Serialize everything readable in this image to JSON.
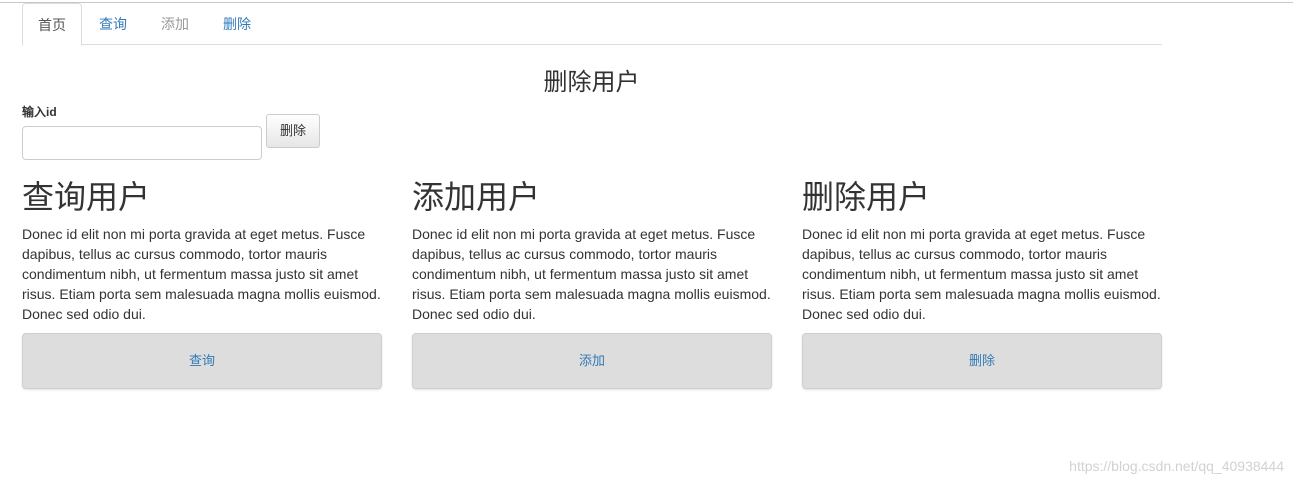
{
  "nav": {
    "tabs": [
      {
        "label": "首页"
      },
      {
        "label": "查询"
      },
      {
        "label": "添加"
      },
      {
        "label": "删除"
      }
    ]
  },
  "form": {
    "title": "删除用户",
    "id_label": "输入id",
    "id_value": "",
    "submit_label": "删除"
  },
  "cards": [
    {
      "heading": "查询用户",
      "body": "Donec id elit non mi porta gravida at eget metus. Fusce dapibus, tellus ac cursus commodo, tortor mauris condimentum nibh, ut fermentum massa justo sit amet risus. Etiam porta sem malesuada magna mollis euismod. Donec sed odio dui.",
      "button": "查询"
    },
    {
      "heading": "添加用户",
      "body": "Donec id elit non mi porta gravida at eget metus. Fusce dapibus, tellus ac cursus commodo, tortor mauris condimentum nibh, ut fermentum massa justo sit amet risus. Etiam porta sem malesuada magna mollis euismod. Donec sed odio dui.",
      "button": "添加"
    },
    {
      "heading": "删除用户",
      "body": "Donec id elit non mi porta gravida at eget metus. Fusce dapibus, tellus ac cursus commodo, tortor mauris condimentum nibh, ut fermentum massa justo sit amet risus. Etiam porta sem malesuada magna mollis euismod. Donec sed odio dui.",
      "button": "删除"
    }
  ],
  "watermark": "https://blog.csdn.net/qq_40938444",
  "colors": {
    "link": "#337ab7",
    "muted": "#999999",
    "card_button_bg": "#dddddd"
  }
}
